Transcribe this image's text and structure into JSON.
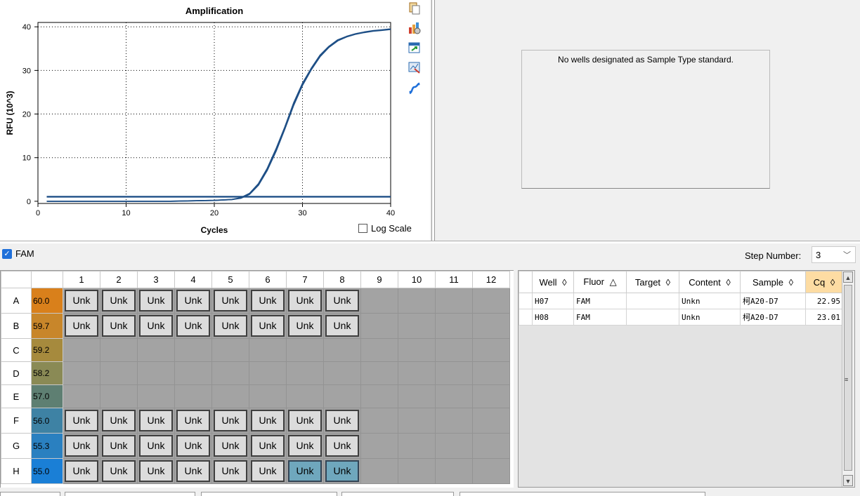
{
  "chart_data": {
    "type": "line",
    "title": "Amplification",
    "xlabel": "Cycles",
    "ylabel": "RFU (10^3)",
    "xlim": [
      0,
      40
    ],
    "ylim": [
      -0.5,
      41
    ],
    "xticks": [
      "0",
      "10",
      "20",
      "30",
      "40"
    ],
    "yticks": [
      "0",
      "10",
      "20",
      "30",
      "40"
    ],
    "grid": true,
    "series": [
      {
        "x": [
          1,
          5,
          10,
          15,
          20,
          22,
          23,
          24,
          25,
          26,
          27,
          28,
          29,
          30,
          31,
          32,
          33,
          34,
          35,
          36,
          37,
          38,
          39,
          40
        ],
        "y": [
          0,
          0,
          0,
          0,
          0.2,
          0.4,
          0.8,
          1.8,
          4,
          7.5,
          12,
          17,
          22.5,
          27,
          30.5,
          33.5,
          35.5,
          37,
          37.8,
          38.4,
          38.8,
          39.1,
          39.3,
          39.5
        ]
      },
      {
        "x": [
          1,
          5,
          10,
          15,
          20,
          22,
          23,
          24,
          25,
          26,
          27,
          28,
          29,
          30,
          31,
          32,
          33,
          34,
          35,
          36,
          37,
          38,
          39,
          40
        ],
        "y": [
          0,
          0,
          0,
          0,
          0.2,
          0.4,
          0.7,
          1.6,
          3.7,
          7.1,
          11.5,
          16.6,
          22,
          26.6,
          30.2,
          33.2,
          35.3,
          36.8,
          37.7,
          38.3,
          38.7,
          39,
          39.2,
          39.4
        ]
      },
      {
        "x": [
          1,
          40
        ],
        "y": [
          1.0,
          1.0
        ]
      },
      {
        "x": [
          1,
          40
        ],
        "y": [
          1.1,
          1.1
        ]
      }
    ]
  },
  "chart_ui": {
    "log_scale_label": "Log Scale"
  },
  "toolbar_icons": [
    "copy-icon",
    "chart-settings-icon",
    "export-icon",
    "zoom-icon",
    "curve-fit-icon"
  ],
  "standard_panel": {
    "message": "No wells designated as Sample Type standard."
  },
  "fluor": {
    "label": "FAM",
    "checked": true
  },
  "step": {
    "label": "Step Number:",
    "value": "3"
  },
  "plate": {
    "columns": [
      "1",
      "2",
      "3",
      "4",
      "5",
      "6",
      "7",
      "8",
      "9",
      "10",
      "11",
      "12"
    ],
    "rows": [
      {
        "label": "A",
        "temp": "60.0",
        "temp_color": "#d9801b",
        "wells": [
          "Unk",
          "Unk",
          "Unk",
          "Unk",
          "Unk",
          "Unk",
          "Unk",
          "Unk",
          "",
          "",
          "",
          ""
        ]
      },
      {
        "label": "B",
        "temp": "59.7",
        "temp_color": "#c8862a",
        "wells": [
          "Unk",
          "Unk",
          "Unk",
          "Unk",
          "Unk",
          "Unk",
          "Unk",
          "Unk",
          "",
          "",
          "",
          ""
        ]
      },
      {
        "label": "C",
        "temp": "59.2",
        "temp_color": "#a68a3d",
        "wells": [
          "",
          "",
          "",
          "",
          "",
          "",
          "",
          "",
          "",
          "",
          "",
          ""
        ]
      },
      {
        "label": "D",
        "temp": "58.2",
        "temp_color": "#8a8a55",
        "wells": [
          "",
          "",
          "",
          "",
          "",
          "",
          "",
          "",
          "",
          "",
          "",
          ""
        ]
      },
      {
        "label": "E",
        "temp": "57.0",
        "temp_color": "#5e7f72",
        "wells": [
          "",
          "",
          "",
          "",
          "",
          "",
          "",
          "",
          "",
          "",
          "",
          ""
        ]
      },
      {
        "label": "F",
        "temp": "56.0",
        "temp_color": "#3e82a4",
        "wells": [
          "Unk",
          "Unk",
          "Unk",
          "Unk",
          "Unk",
          "Unk",
          "Unk",
          "Unk",
          "",
          "",
          "",
          ""
        ]
      },
      {
        "label": "G",
        "temp": "55.3",
        "temp_color": "#2a80c0",
        "wells": [
          "Unk",
          "Unk",
          "Unk",
          "Unk",
          "Unk",
          "Unk",
          "Unk",
          "Unk",
          "",
          "",
          "",
          ""
        ]
      },
      {
        "label": "H",
        "temp": "55.0",
        "temp_color": "#1a7fd6",
        "wells": [
          "Unk",
          "Unk",
          "Unk",
          "Unk",
          "Unk",
          "Unk",
          "Unk",
          "Unk",
          "",
          "",
          "",
          ""
        ]
      }
    ],
    "selected_wells": [
      "H7",
      "H8"
    ]
  },
  "results": {
    "columns": [
      {
        "label": "Well",
        "sort": "◊"
      },
      {
        "label": "Fluor",
        "sort": "△"
      },
      {
        "label": "Target",
        "sort": "◊"
      },
      {
        "label": "Content",
        "sort": "◊"
      },
      {
        "label": "Sample",
        "sort": "◊"
      },
      {
        "label": "Cq",
        "sort": "◊"
      }
    ],
    "rows": [
      [
        "H07",
        "FAM",
        "",
        "Unkn",
        "柯A20-D7",
        "22.95"
      ],
      [
        "H08",
        "FAM",
        "",
        "Unkn",
        "柯A20-D7",
        "23.01"
      ]
    ]
  }
}
